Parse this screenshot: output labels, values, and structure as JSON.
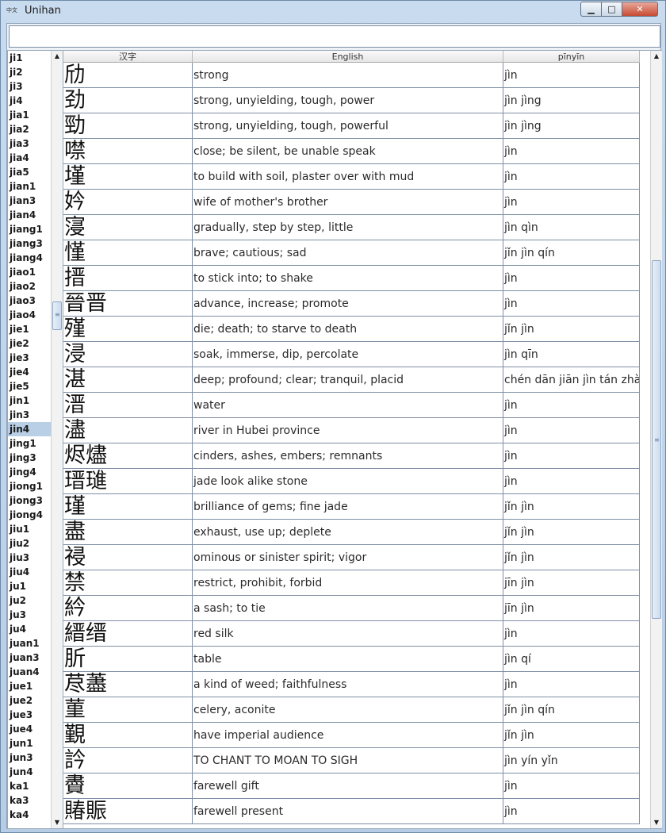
{
  "window": {
    "title": "Unihan",
    "icon_text": "中文"
  },
  "search": {
    "value": ""
  },
  "syllables": [
    "ji1",
    "ji2",
    "ji3",
    "ji4",
    "jia1",
    "jia2",
    "jia3",
    "jia4",
    "jia5",
    "jian1",
    "jian3",
    "jian4",
    "jiang1",
    "jiang3",
    "jiang4",
    "jiao1",
    "jiao2",
    "jiao3",
    "jiao4",
    "jie1",
    "jie2",
    "jie3",
    "jie4",
    "jie5",
    "jin1",
    "jin3",
    "jin4",
    "jing1",
    "jing3",
    "jing4",
    "jiong1",
    "jiong3",
    "jiong4",
    "jiu1",
    "jiu2",
    "jiu3",
    "jiu4",
    "ju1",
    "ju2",
    "ju3",
    "ju4",
    "juan1",
    "juan3",
    "juan4",
    "jue1",
    "jue2",
    "jue3",
    "jue4",
    "jun1",
    "jun3",
    "jun4",
    "ka1",
    "ka3",
    "ka4"
  ],
  "selected_syllable": "jin4",
  "table": {
    "headers": [
      "汉字",
      "English",
      "pīnyīn"
    ],
    "rows": [
      [
        "劤",
        "strong",
        "jìn"
      ],
      [
        "劲",
        "strong, unyielding, tough, power",
        "jìn jìng"
      ],
      [
        "勁",
        "strong, unyielding, tough, powerful",
        "jìn jìng"
      ],
      [
        "噤",
        "close; be silent, be unable speak",
        "jìn"
      ],
      [
        "墐",
        "to build with soil, plaster over with mud",
        "jìn"
      ],
      [
        "妗",
        "wife of mother's brother",
        "jìn"
      ],
      [
        "寖",
        "gradually, step by step, little",
        "jìn qìn"
      ],
      [
        "慬",
        "brave; cautious; sad",
        "jǐn jìn qín"
      ],
      [
        "搢",
        "to stick into; to shake",
        "jìn"
      ],
      [
        "晉晋",
        "advance, increase; promote",
        "jìn"
      ],
      [
        "殣",
        "die; death; to starve to death",
        "jǐn jìn"
      ],
      [
        "浸",
        "soak, immerse, dip, percolate",
        "jìn qīn"
      ],
      [
        "湛",
        "deep; profound; clear; tranquil, placid",
        "chén dān jiān jìn tán zhàn"
      ],
      [
        "溍",
        "water",
        "jìn"
      ],
      [
        "濜",
        "river in Hubei province",
        "jìn"
      ],
      [
        "烬燼",
        "cinders, ashes, embers; remnants",
        "jìn"
      ],
      [
        "瑨璡",
        "jade look alike stone",
        "jìn"
      ],
      [
        "瑾",
        "brilliance of gems; fine jade",
        "jǐn jìn"
      ],
      [
        "盡",
        "exhaust, use up; deplete",
        "jǐn jìn"
      ],
      [
        "祲",
        "ominous or sinister spirit; vigor",
        "jǐn jìn"
      ],
      [
        "禁",
        "restrict, prohibit, forbid",
        "jīn jìn"
      ],
      [
        "紟",
        "a sash; to tie",
        "jīn jìn"
      ],
      [
        "縉缙",
        "red silk",
        "jìn"
      ],
      [
        "肵",
        "table",
        "jìn qí"
      ],
      [
        "荩藎",
        "a kind of weed; faithfulness",
        "jìn"
      ],
      [
        "菫",
        "celery, aconite",
        "jǐn jìn qín"
      ],
      [
        "覲",
        "have imperial audience",
        "jǐn jìn"
      ],
      [
        "訡",
        "TO CHANT TO MOAN TO SIGH",
        "jìn yín yǐn"
      ],
      [
        "賮",
        "farewell gift",
        "jìn"
      ],
      [
        "賰賑",
        "farewell present",
        "jìn"
      ]
    ]
  },
  "scroll": {
    "list_position_fraction": 0.33,
    "table_position_fraction": 0.5
  }
}
